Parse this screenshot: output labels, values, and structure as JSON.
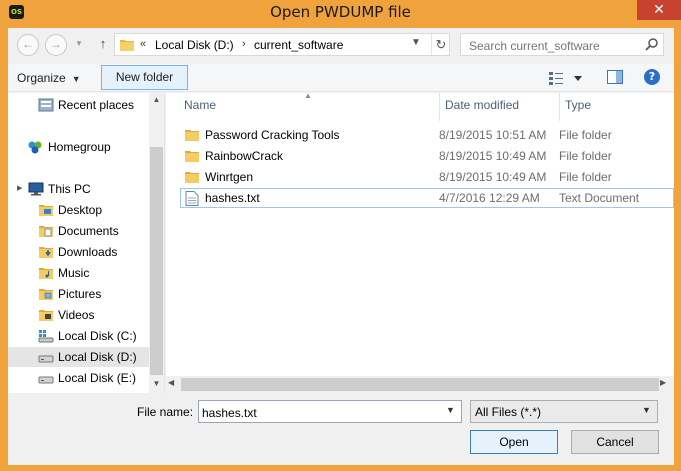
{
  "window": {
    "title": "Open PWDUMP file",
    "app_badge": "OS",
    "close_label": "✕"
  },
  "address": {
    "prefix": "«",
    "crumbs": [
      "Local Disk (D:)",
      "current_software"
    ],
    "separator": "›"
  },
  "search": {
    "placeholder": "Search current_software"
  },
  "toolbar": {
    "organize_label": "Organize",
    "new_folder_label": "New folder"
  },
  "nav": {
    "items": [
      {
        "label": "Recent places",
        "icon": "recent-places-icon"
      },
      {
        "label": "Homegroup",
        "icon": "homegroup-icon"
      },
      {
        "label": "This PC",
        "icon": "computer-icon"
      },
      {
        "label": "Desktop",
        "icon": "folder-icon"
      },
      {
        "label": "Documents",
        "icon": "folder-icon"
      },
      {
        "label": "Downloads",
        "icon": "folder-icon"
      },
      {
        "label": "Music",
        "icon": "folder-icon"
      },
      {
        "label": "Pictures",
        "icon": "folder-icon"
      },
      {
        "label": "Videos",
        "icon": "folder-icon"
      },
      {
        "label": "Local Disk (C:)",
        "icon": "drive-icon"
      },
      {
        "label": "Local Disk (D:)",
        "icon": "drive-icon",
        "selected": true
      },
      {
        "label": "Local Disk (E:)",
        "icon": "drive-icon"
      }
    ]
  },
  "files": {
    "columns": [
      "Name",
      "Date modified",
      "Type"
    ],
    "rows": [
      {
        "name": "Password Cracking Tools",
        "date": "8/19/2015 10:51 AM",
        "type": "File folder",
        "icon": "folder-icon"
      },
      {
        "name": "RainbowCrack",
        "date": "8/19/2015 10:49 AM",
        "type": "File folder",
        "icon": "folder-icon"
      },
      {
        "name": "Winrtgen",
        "date": "8/19/2015 10:49 AM",
        "type": "File folder",
        "icon": "folder-icon"
      },
      {
        "name": "hashes.txt",
        "date": "4/7/2016 12:29 AM",
        "type": "Text Document",
        "icon": "text-file-icon",
        "selected": true
      }
    ]
  },
  "bottom": {
    "file_name_label": "File name:",
    "file_name_value": "hashes.txt",
    "filter_value": "All Files (*.*)",
    "open_label": "Open",
    "cancel_label": "Cancel"
  },
  "colors": {
    "title_bar": "#f0a23c",
    "close_button": "#c7432f",
    "selection": "#99c9ef"
  }
}
